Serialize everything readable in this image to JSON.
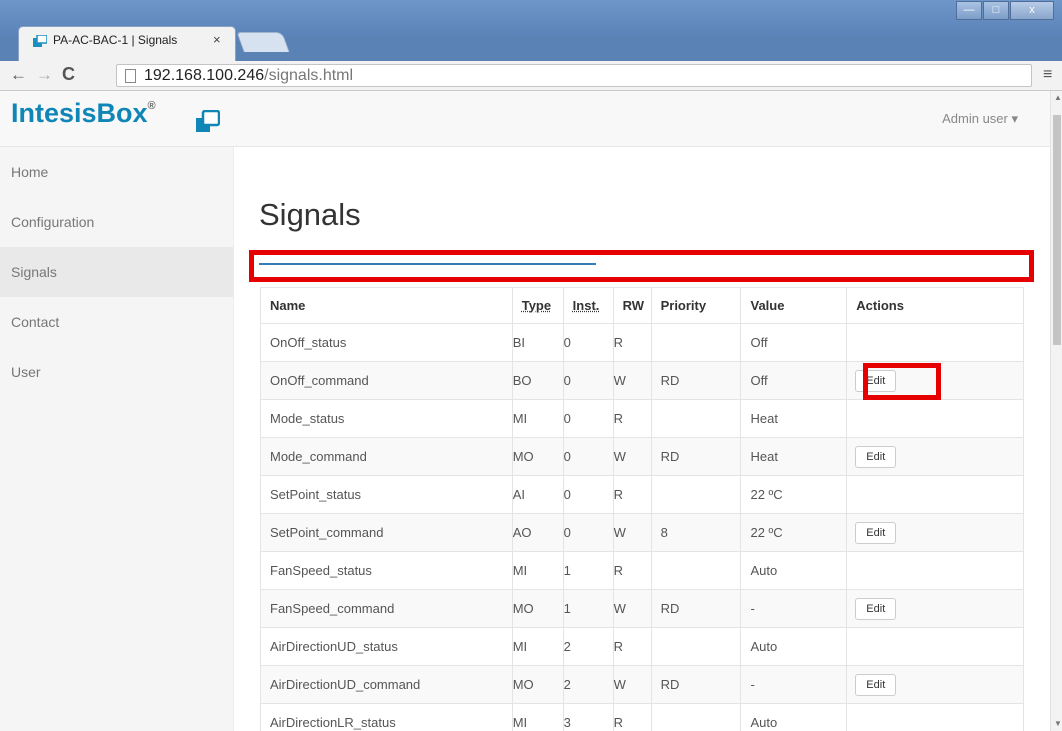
{
  "browser": {
    "tab_title": "PA-AC-BAC-1 | Signals",
    "tab_close": "×",
    "url_host": "192.168.100.246",
    "url_path": "/signals.html",
    "back": "←",
    "forward": "→",
    "reload": "C",
    "menu": "≡",
    "win_min": "—",
    "win_max": "□",
    "win_close": "x"
  },
  "navbar": {
    "brand": "IntesisBox",
    "brand_mark": "®",
    "user_menu": "Admin user ▾"
  },
  "sidebar": {
    "items": [
      {
        "label": "Home"
      },
      {
        "label": "Configuration"
      },
      {
        "label": "Signals"
      },
      {
        "label": "Contact"
      },
      {
        "label": "User"
      }
    ],
    "active": "Signals"
  },
  "main": {
    "title": "Signals",
    "table": {
      "headers": [
        "Name",
        "Type",
        "Inst.",
        "RW",
        "Priority",
        "Value",
        "Actions"
      ],
      "edit_label": "Edit",
      "rows": [
        {
          "name": "OnOff_status",
          "type": "BI",
          "inst": "0",
          "rw": "R",
          "priority": "",
          "value": "Off",
          "edit": false
        },
        {
          "name": "OnOff_command",
          "type": "BO",
          "inst": "0",
          "rw": "W",
          "priority": "RD",
          "value": "Off",
          "edit": true
        },
        {
          "name": "Mode_status",
          "type": "MI",
          "inst": "0",
          "rw": "R",
          "priority": "",
          "value": "Heat",
          "edit": false
        },
        {
          "name": "Mode_command",
          "type": "MO",
          "inst": "0",
          "rw": "W",
          "priority": "RD",
          "value": "Heat",
          "edit": true
        },
        {
          "name": "SetPoint_status",
          "type": "AI",
          "inst": "0",
          "rw": "R",
          "priority": "",
          "value": "22 ºC",
          "edit": false
        },
        {
          "name": "SetPoint_command",
          "type": "AO",
          "inst": "0",
          "rw": "W",
          "priority": "8",
          "value": "22 ºC",
          "edit": true
        },
        {
          "name": "FanSpeed_status",
          "type": "MI",
          "inst": "1",
          "rw": "R",
          "priority": "",
          "value": "Auto",
          "edit": false
        },
        {
          "name": "FanSpeed_command",
          "type": "MO",
          "inst": "1",
          "rw": "W",
          "priority": "RD",
          "value": "-",
          "edit": true
        },
        {
          "name": "AirDirectionUD_status",
          "type": "MI",
          "inst": "2",
          "rw": "R",
          "priority": "",
          "value": "Auto",
          "edit": false
        },
        {
          "name": "AirDirectionUD_command",
          "type": "MO",
          "inst": "2",
          "rw": "W",
          "priority": "RD",
          "value": "-",
          "edit": true
        },
        {
          "name": "AirDirectionLR_status",
          "type": "MI",
          "inst": "3",
          "rw": "R",
          "priority": "",
          "value": "Auto",
          "edit": false
        }
      ]
    }
  },
  "colors": {
    "brand": "#0f86b5",
    "highlight": "#e60000",
    "rule": "#337ab7"
  }
}
